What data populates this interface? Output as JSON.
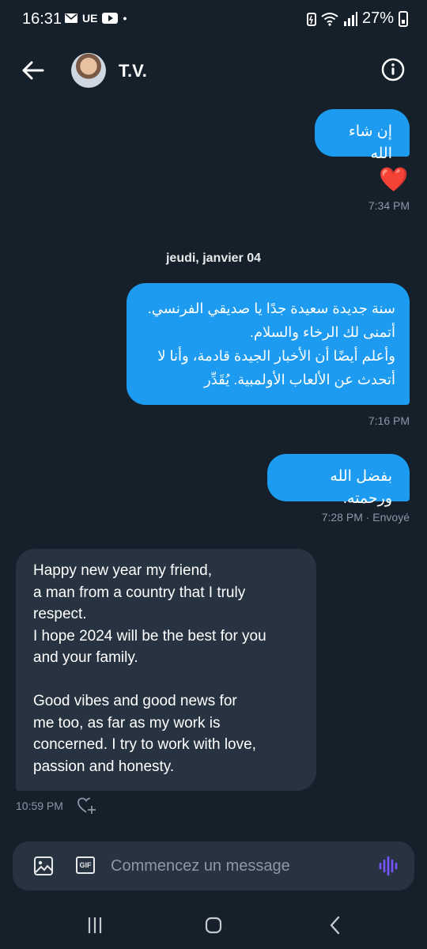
{
  "status_bar": {
    "time": "16:31",
    "carrier_label": "UE",
    "battery": "27%"
  },
  "header": {
    "contact_name": "T.V."
  },
  "messages": [
    {
      "type": "sent",
      "text": "إن شاء الله"
    },
    {
      "type": "reaction",
      "emoji": "❤️",
      "time": "7:34 PM"
    },
    {
      "type": "day_separator",
      "text": "jeudi, janvier 04"
    },
    {
      "type": "sent",
      "lines": [
        "سنة جديدة سعيدة جدًا يا صديقي الفرنسي.",
        "أتمنى لك الرخاء والسلام.",
        "وأعلم أيضًا أن الأخبار الجيدة قادمة، وأنا لا",
        "أتحدث عن الألعاب الأولمبية. يُقَدِّر"
      ],
      "time": "7:16 PM"
    },
    {
      "type": "sent",
      "text": "بفضل الله ورحمته.",
      "time": "7:28 PM · Envoyé"
    },
    {
      "type": "received",
      "lines": [
        "Happy new year my friend,",
        "a man from a country that I truly",
        "respect.",
        "I hope 2024 will be the best for you",
        "and your family.",
        "",
        "Good vibes and good news for",
        "me too, as far as my work is",
        "concerned. I try to work with love,",
        "passion and honesty."
      ],
      "time": "10:59 PM"
    }
  ],
  "composer": {
    "placeholder": "Commencez un message",
    "gif_label": "GIF"
  },
  "colors": {
    "background": "#15202b",
    "sent_bubble": "#1d9bf0",
    "received_bubble": "#273340",
    "accent_voice": "#7856ff"
  }
}
